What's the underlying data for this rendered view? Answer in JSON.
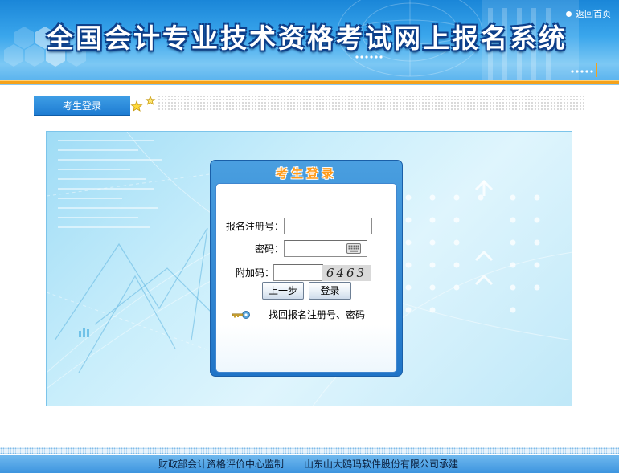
{
  "header": {
    "title": "全国会计专业技术资格考试网上报名系统",
    "home_link": "返回首页"
  },
  "tab": {
    "label": "考生登录"
  },
  "login": {
    "title": "考生登录",
    "reg_no_label": "报名注册号：",
    "reg_no_value": "",
    "password_label": "密码：",
    "password_value": "",
    "captcha_label": "附加码：",
    "captcha_value": "",
    "captcha_image_text": "6463",
    "prev_button": "上一步",
    "login_button": "登录",
    "recover_link": "找回报名注册号、密码"
  },
  "footer": {
    "supervisor": "财政部会计资格评价中心监制",
    "builder": "山东山大鸥玛软件股份有限公司承建"
  },
  "colors": {
    "brand_blue": "#1f74c7",
    "accent_orange": "#f5a21b",
    "login_title_orange": "#ff9a1a"
  }
}
